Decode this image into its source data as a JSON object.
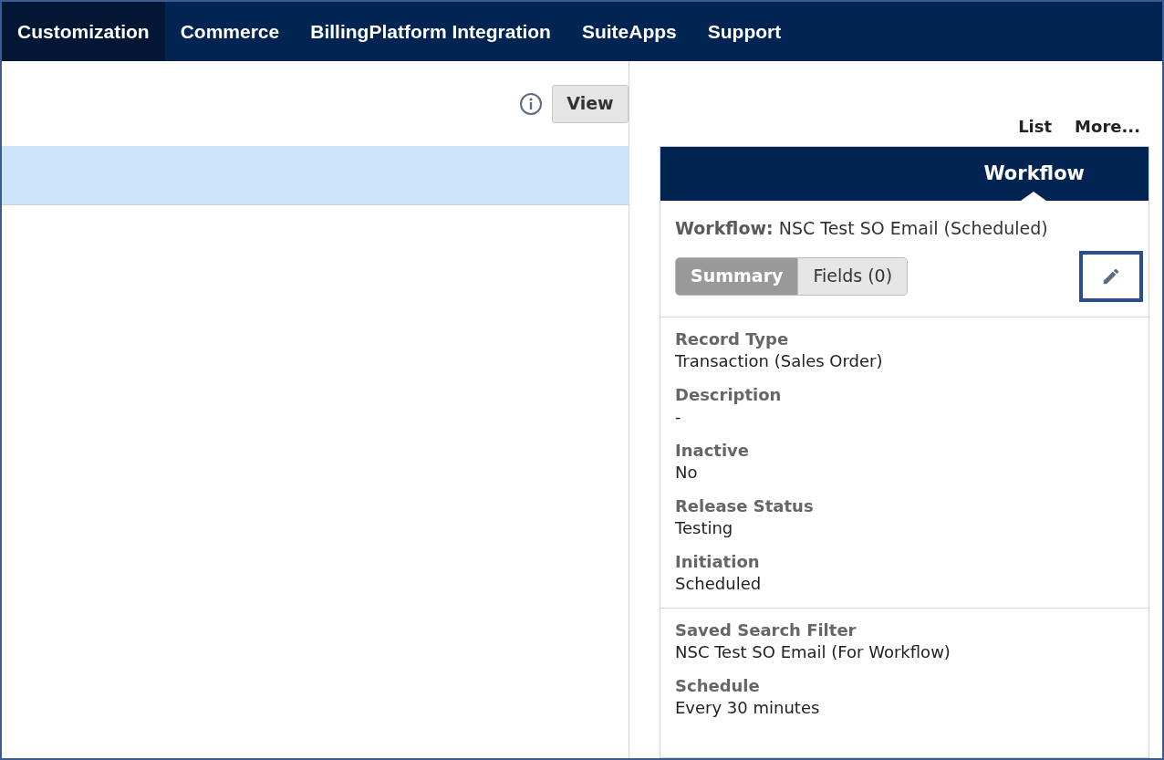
{
  "nav": [
    {
      "label": "Customization",
      "selected": true
    },
    {
      "label": "Commerce",
      "selected": false
    },
    {
      "label": "BillingPlatform Integration",
      "selected": false
    },
    {
      "label": "SuiteApps",
      "selected": false
    },
    {
      "label": "Support",
      "selected": false
    }
  ],
  "toolbar": {
    "view_button": "View"
  },
  "links": [
    "List",
    "More..."
  ],
  "panel": {
    "header": "Workflow",
    "title_label": "Workflow:",
    "title_value": "NSC Test SO Email (Scheduled)",
    "tabs": [
      {
        "label": "Summary",
        "selected": true
      },
      {
        "label": "Fields (0)",
        "selected": false
      }
    ],
    "sections": [
      {
        "fields": [
          {
            "label": "Record Type",
            "value": "Transaction (Sales Order)"
          },
          {
            "label": "Description",
            "value": "-"
          },
          {
            "label": "Inactive",
            "value": "No"
          },
          {
            "label": "Release Status",
            "value": "Testing"
          },
          {
            "label": "Initiation",
            "value": "Scheduled"
          }
        ]
      },
      {
        "fields": [
          {
            "label": "Saved Search Filter",
            "value": "NSC Test SO Email (For Workflow)"
          },
          {
            "label": "Schedule",
            "value": "Every 30 minutes"
          }
        ]
      }
    ]
  }
}
